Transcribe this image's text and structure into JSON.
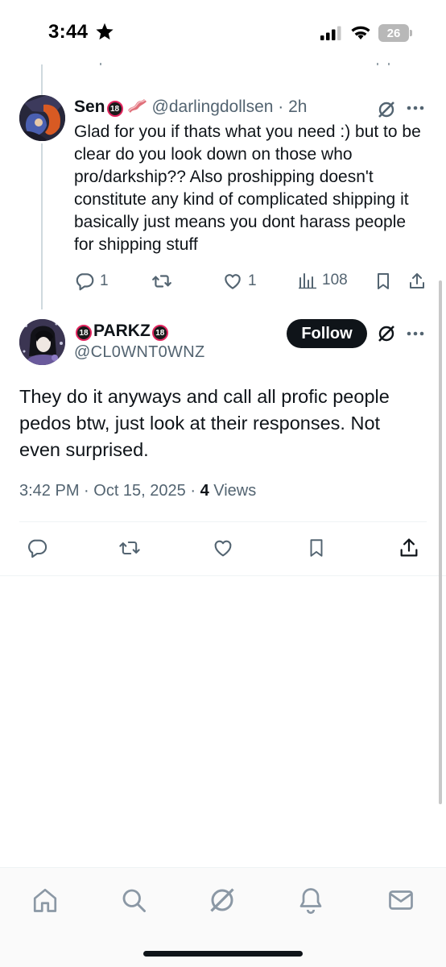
{
  "status_bar": {
    "time": "3:44",
    "battery": "26"
  },
  "reply": {
    "name": "Sen",
    "badge": "18",
    "handle": "@darlingdollsen",
    "age": " · 2h",
    "text": "Glad for you if thats what you need :) but to be clear do you look down on those who pro/darkship?? Also proshipping doesn't constitute any kind of complicated shipping it basically just means you dont harass people for shipping stuff",
    "counts": {
      "replies": "1",
      "likes": "1",
      "views": "108"
    }
  },
  "tweet": {
    "name_badge_left": "18",
    "name": "PARKZ",
    "name_badge_right": "18",
    "handle": "@CL0WNT0WNZ",
    "follow_label": "Follow",
    "text": "They do it anyways and call all profic people pedos btw, just look at their responses. Not even surprised.",
    "timestamp": "3:42 PM · Oct 15, 2025 · ",
    "views_count": "4",
    "views_label": " Views"
  },
  "icons": {
    "status": [
      "star-icon",
      "cellular-signal-icon",
      "wifi-icon",
      "battery-icon"
    ],
    "tweet_actions": [
      "reply-icon",
      "retweet-icon",
      "like-icon",
      "views-icon",
      "bookmark-icon",
      "share-icon"
    ],
    "tabs": [
      "home-icon",
      "search-icon",
      "grok-icon",
      "notifications-icon",
      "messages-icon"
    ]
  },
  "colors": {
    "text": "#0f1419",
    "secondary": "#536471",
    "follow_bg": "#0f1419",
    "divider": "#eff3f4"
  }
}
